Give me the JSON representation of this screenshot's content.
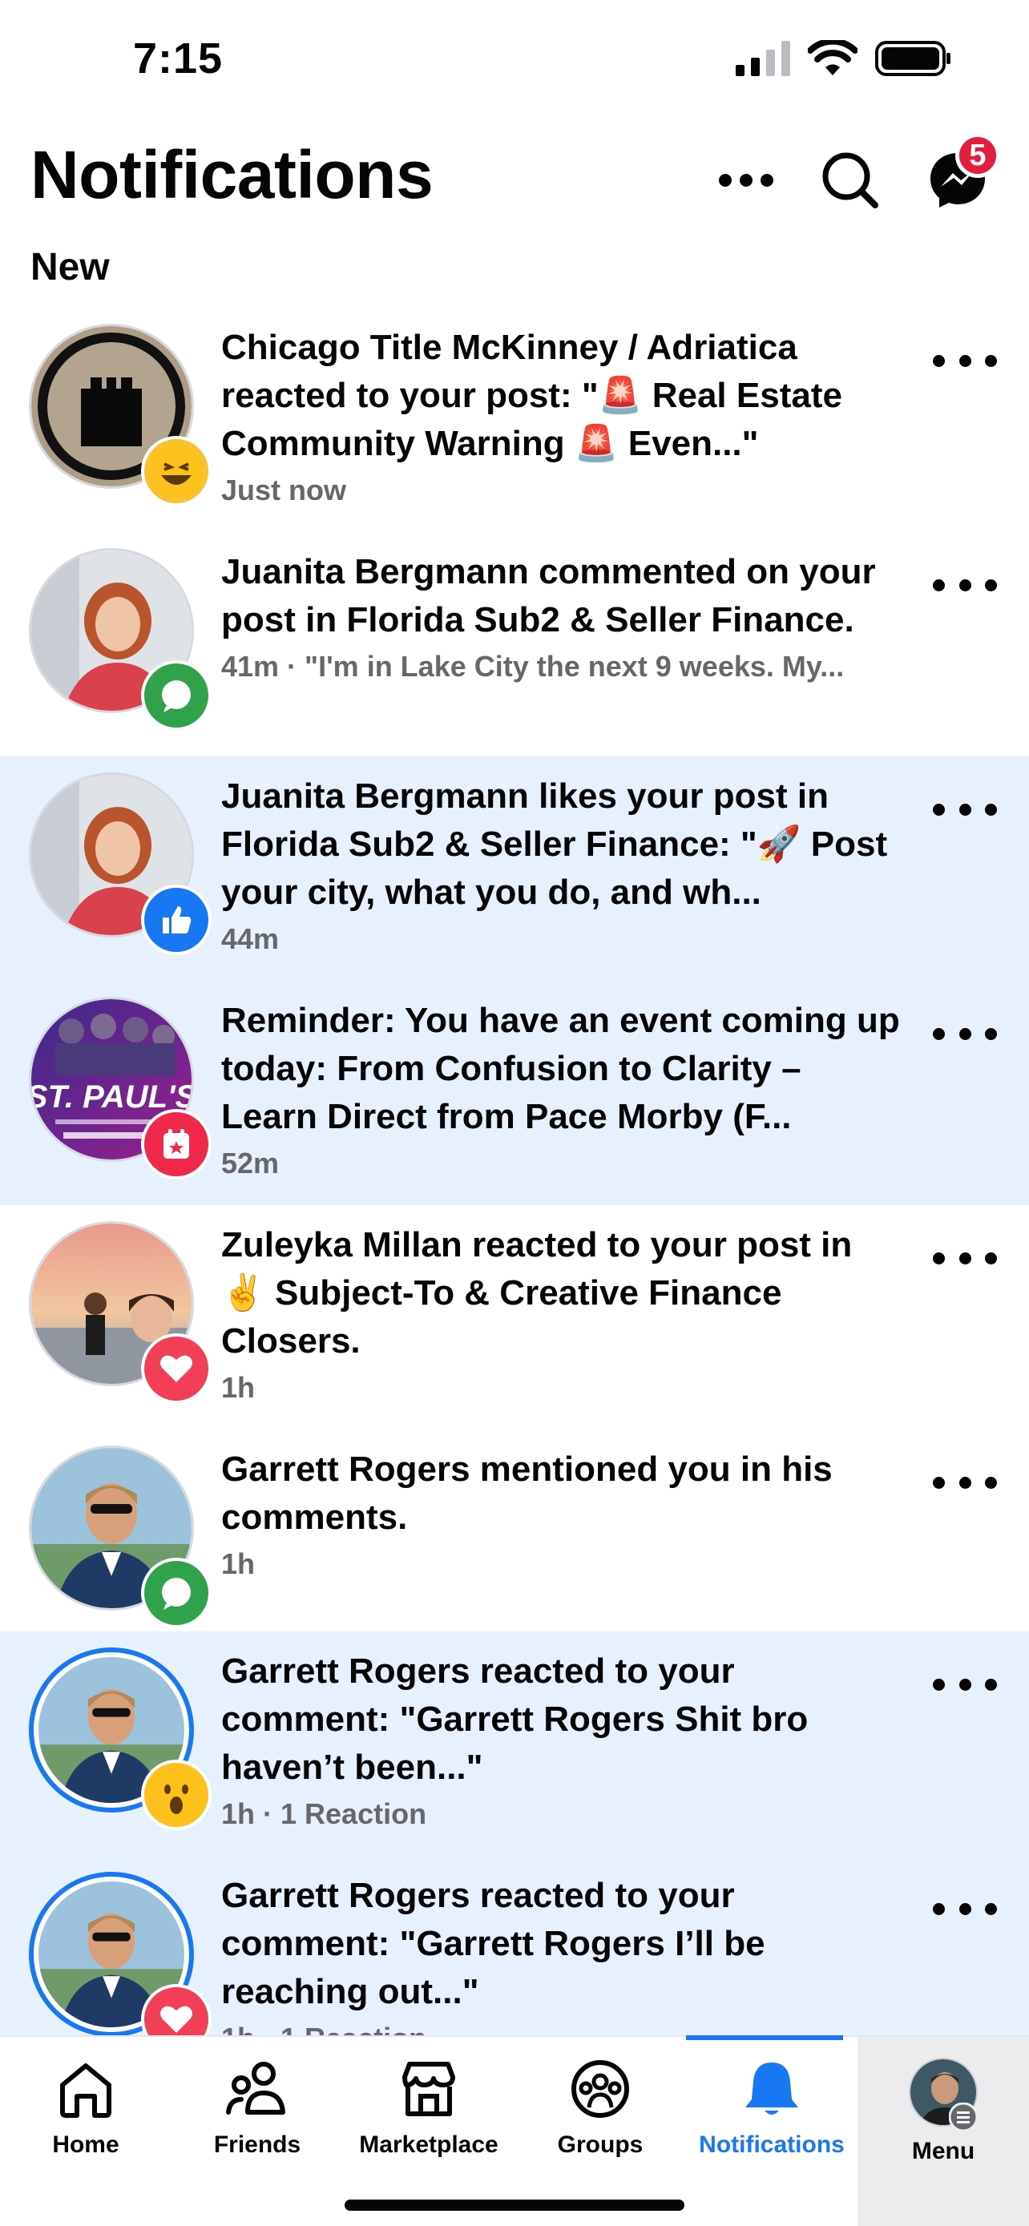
{
  "status_bar": {
    "time": "7:15"
  },
  "header": {
    "title": "Notifications",
    "messenger_badge": "5"
  },
  "section": {
    "label": "New"
  },
  "notifications": [
    {
      "text": "Chicago Title McKinney / Adriatica reacted to your post: \"🚨 Real Estate Community Warning 🚨 Even...\"",
      "meta": "Just now",
      "reaction": "haha",
      "unread": false
    },
    {
      "text": "Juanita Bergmann commented on your post in Florida Sub2 & Seller Finance.",
      "meta": "41m · \"I'm in Lake City the next 9 weeks. My...",
      "reaction": "comment",
      "unread": false
    },
    {
      "text": "Juanita Bergmann likes your post in Florida Sub2 & Seller Finance: \"🚀 Post your city, what you do, and wh...",
      "meta": "44m",
      "reaction": "like",
      "unread": true
    },
    {
      "text": "Reminder: You have an event coming up today: From Confusion to Clarity – Learn Direct from Pace Morby (F...",
      "meta": "52m",
      "reaction": "event",
      "unread": true,
      "avatar_text": "ST. PAUL'S"
    },
    {
      "text": "Zuleyka Millan reacted to your post in ✌️ Subject-To & Creative Finance Closers.",
      "meta": "1h",
      "reaction": "love",
      "unread": false
    },
    {
      "text": "Garrett Rogers mentioned you in his comments.",
      "meta": "1h",
      "reaction": "comment",
      "unread": false
    },
    {
      "text": "Garrett Rogers reacted to your comment: \"Garrett Rogers Shit bro haven’t been...\"",
      "meta": "1h · 1 Reaction",
      "reaction": "wow",
      "unread": true
    },
    {
      "text": "Garrett Rogers reacted to your comment: \"Garrett Rogers I’ll be reaching out...\"",
      "meta": "1h · 1 Reaction",
      "reaction": "love",
      "unread": true
    }
  ],
  "tabs": [
    {
      "label": "Home",
      "icon": "home-icon"
    },
    {
      "label": "Friends",
      "icon": "friends-icon"
    },
    {
      "label": "Marketplace",
      "icon": "marketplace-icon"
    },
    {
      "label": "Groups",
      "icon": "groups-icon"
    },
    {
      "label": "Notifications",
      "icon": "bell-icon",
      "active": true
    },
    {
      "label": "Menu",
      "icon": "profile-avatar"
    }
  ],
  "colors": {
    "accent": "#1877f2",
    "unread_bg": "#e7f0fd",
    "badge": "#e41e3f",
    "secondary_text": "#65676b"
  }
}
